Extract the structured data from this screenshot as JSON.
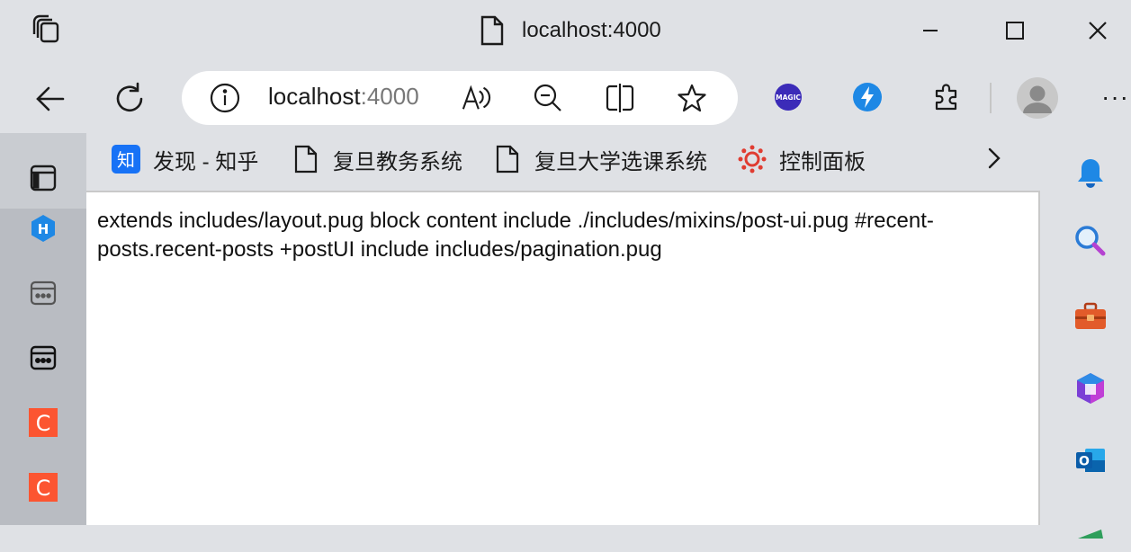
{
  "window": {
    "title": "localhost:4000"
  },
  "address_bar": {
    "host": "localhost",
    "port": ":4000"
  },
  "favorites": [
    {
      "label": "发现 - 知乎",
      "icon": "zhihu-icon",
      "icon_text": "知"
    },
    {
      "label": "复旦教务系统",
      "icon": "page-icon"
    },
    {
      "label": "复旦大学选课系统",
      "icon": "page-icon"
    },
    {
      "label": "控制面板",
      "icon": "canvas-icon"
    }
  ],
  "left_sidebar": [
    {
      "icon": "tab-view-icon"
    },
    {
      "icon": "h-hexagon-icon",
      "text": "H"
    },
    {
      "icon": "calendar-dots-icon"
    },
    {
      "icon": "calendar-dots-icon"
    },
    {
      "icon": "c-app-icon",
      "text": "C"
    },
    {
      "icon": "c-app-icon",
      "text": "C"
    }
  ],
  "extensions": [
    {
      "icon": "magic-icon",
      "text": "MAGIC"
    },
    {
      "icon": "lightning-icon"
    },
    {
      "icon": "puzzle-icon"
    }
  ],
  "right_sidebar": [
    {
      "icon": "bell-icon"
    },
    {
      "icon": "search-icon"
    },
    {
      "icon": "toolbox-icon"
    },
    {
      "icon": "office-icon"
    },
    {
      "icon": "outlook-icon",
      "text": "O"
    }
  ],
  "page": {
    "content": "extends includes/layout.pug block content include ./includes/mixins/post-ui.pug #recent-posts.recent-posts +postUI include includes/pagination.pug"
  },
  "colors": {
    "chrome": "#dfe1e5",
    "zhihu": "#1772f6",
    "c_app": "#fc5531",
    "h_app": "#1e88e5",
    "bolt": "#1e88e5",
    "canvas": "#e03c31",
    "bell": "#1e88e5",
    "toolbox": "#e25b2a",
    "outlook": "#0a64ad"
  }
}
